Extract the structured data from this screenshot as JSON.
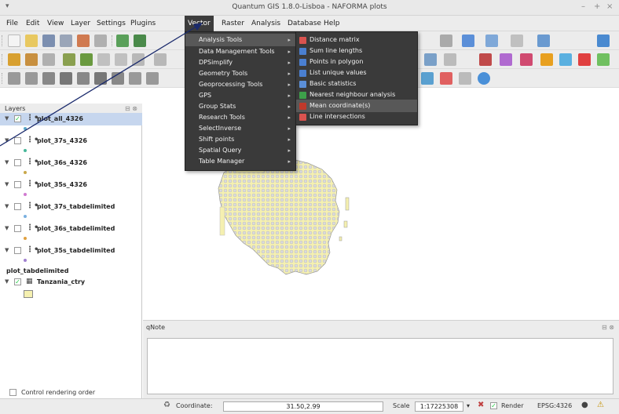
{
  "window": {
    "title": "Quantum GIS 1.8.0-Lisboa - NAFORMA plots",
    "controls": [
      "–",
      "+",
      "×"
    ]
  },
  "menubar": {
    "items": [
      "File",
      "Edit",
      "View",
      "Layer",
      "Settings",
      "Plugins",
      "Vector",
      "Raster",
      "Analysis",
      "Database",
      "Help"
    ],
    "active": "Vector"
  },
  "vector_menu": {
    "items": [
      "Analysis Tools",
      "Data Management Tools",
      "DPSimplify",
      "Geometry Tools",
      "Geoprocessing Tools",
      "GPS",
      "Group Stats",
      "Research Tools",
      "SelectInverse",
      "Shift points",
      "Spatial Query",
      "Table Manager"
    ],
    "highlighted": "Analysis Tools"
  },
  "analysis_submenu": {
    "items": [
      {
        "label": "Distance matrix",
        "icon": "distance-matrix-icon",
        "color": "#d9534f"
      },
      {
        "label": "Sum line lengths",
        "icon": "sum-lines-icon",
        "color": "#4a7fd1"
      },
      {
        "label": "Points in polygon",
        "icon": "points-in-polygon-icon",
        "color": "#4a7fd1"
      },
      {
        "label": "List unique values",
        "icon": "list-unique-icon",
        "color": "#4a7fd1"
      },
      {
        "label": "Basic statistics",
        "icon": "basic-statistics-icon",
        "color": "#5b8fd8"
      },
      {
        "label": "Nearest neighbour analysis",
        "icon": "nearest-neighbour-icon",
        "color": "#3da04a"
      },
      {
        "label": "Mean coordinate(s)",
        "icon": "mean-coordinate-icon",
        "color": "#c0392b"
      },
      {
        "label": "Line intersections",
        "icon": "line-intersections-icon",
        "color": "#d9534f"
      }
    ],
    "highlighted": "Mean coordinate(s)"
  },
  "layers_panel": {
    "title": "Layers",
    "header_buttons": "⊟ ⊗",
    "layers": [
      {
        "name": "plot_all_4326",
        "checked": true,
        "selected": true,
        "symbol_color": "#5aa7c8"
      },
      {
        "name": "plot_37s_4326",
        "checked": false,
        "selected": false,
        "symbol_color": "#48b89a"
      },
      {
        "name": "plot_36s_4326",
        "checked": false,
        "selected": false,
        "symbol_color": "#c9a84a"
      },
      {
        "name": "plot_35s_4326",
        "checked": false,
        "selected": false,
        "symbol_color": "#d07ad0"
      },
      {
        "name": "plot_37s_tabdelimited",
        "checked": false,
        "selected": false,
        "symbol_color": "#7ab0e0"
      },
      {
        "name": "plot_36s_tabdelimited",
        "checked": false,
        "selected": false,
        "symbol_color": "#e0a040"
      },
      {
        "name": "plot_35s_tabdelimited",
        "checked": false,
        "selected": false,
        "symbol_color": "#a080d0"
      }
    ],
    "group_layer": "plot_tabdelimited",
    "country_layer": {
      "name": "Tanzania_ctry",
      "checked": true,
      "fill": "#f5f0b0"
    },
    "render_order_label": "Control rendering order"
  },
  "qnote": {
    "title": "qNote",
    "buttons": "⊟ ⊗"
  },
  "statusbar": {
    "coordinate_label": "Coordinate:",
    "coordinate_value": "31.50,2.99",
    "scale_label": "Scale",
    "scale_value": "1:17225308",
    "render_label": "Render",
    "crs": "EPSG:4326"
  },
  "colors": {
    "menu_bg": "#3a3a3a",
    "selection": "#c6d6ee",
    "map_fill": "#f5f0b0",
    "map_points": "#d8d8d8"
  }
}
